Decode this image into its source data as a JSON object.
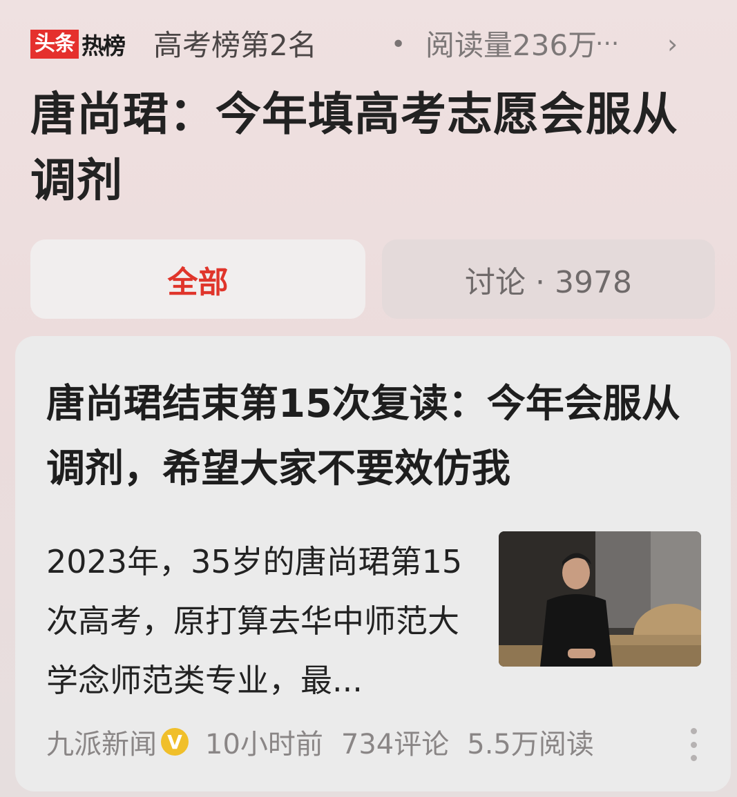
{
  "topbar": {
    "logo_box": "头条",
    "logo_hot": "热榜",
    "rank": "高考榜第2名",
    "separator": "•",
    "reads": "阅读量236万",
    "more": "···",
    "chevron": "›"
  },
  "headline": "唐尚珺：今年填高考志愿会服从调剂",
  "tabs": {
    "all": "全部",
    "discuss": "讨论 · 3978"
  },
  "article": {
    "title": "唐尚珺结束第15次复读：今年会服从调剂，希望大家不要效仿我",
    "excerpt": "2023年，35岁的唐尚珺第15次高考，原打算去华中师范大学念师范类专业，最...",
    "source": "九派新闻",
    "verified_badge": "V",
    "time": "10小时前",
    "comments": "734评论",
    "reads": "5.5万阅读"
  },
  "icons": {
    "verified": "verified-badge-icon",
    "more": "more-options-icon",
    "chevron": "chevron-right-icon"
  },
  "colors": {
    "accent_red": "#e0352b",
    "logo_red": "#e5302d",
    "badge_gold": "#f0bf2a"
  }
}
